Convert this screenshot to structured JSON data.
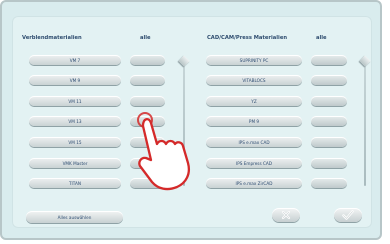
{
  "left_panel": {
    "title": "Verblendmaterialien",
    "all_label": "alle",
    "items": [
      {
        "label": "VM 7"
      },
      {
        "label": "VM 9"
      },
      {
        "label": "VM 11"
      },
      {
        "label": "VM 13"
      },
      {
        "label": "VM 15"
      },
      {
        "label": "VMK Master"
      },
      {
        "label": "TITAN"
      }
    ]
  },
  "right_panel": {
    "title": "CAD/CAM/Press Materialien",
    "all_label": "alle",
    "items": [
      {
        "label": "SUPRINITY PC"
      },
      {
        "label": "VITABLOCS"
      },
      {
        "label": "YZ"
      },
      {
        "label": "PM 9"
      },
      {
        "label": "IPS e.max CAD"
      },
      {
        "label": "IPS Empress CAD"
      },
      {
        "label": "IPS e.max ZirCAD"
      }
    ]
  },
  "footer": {
    "select_all_label": "Alles auswählen",
    "cancel_icon": "close-icon",
    "confirm_icon": "check-icon"
  },
  "colors": {
    "background": "#d9ecee",
    "text": "#2c4b70",
    "button_top": "#eef1f1",
    "button_bottom": "#c9d2d3"
  }
}
